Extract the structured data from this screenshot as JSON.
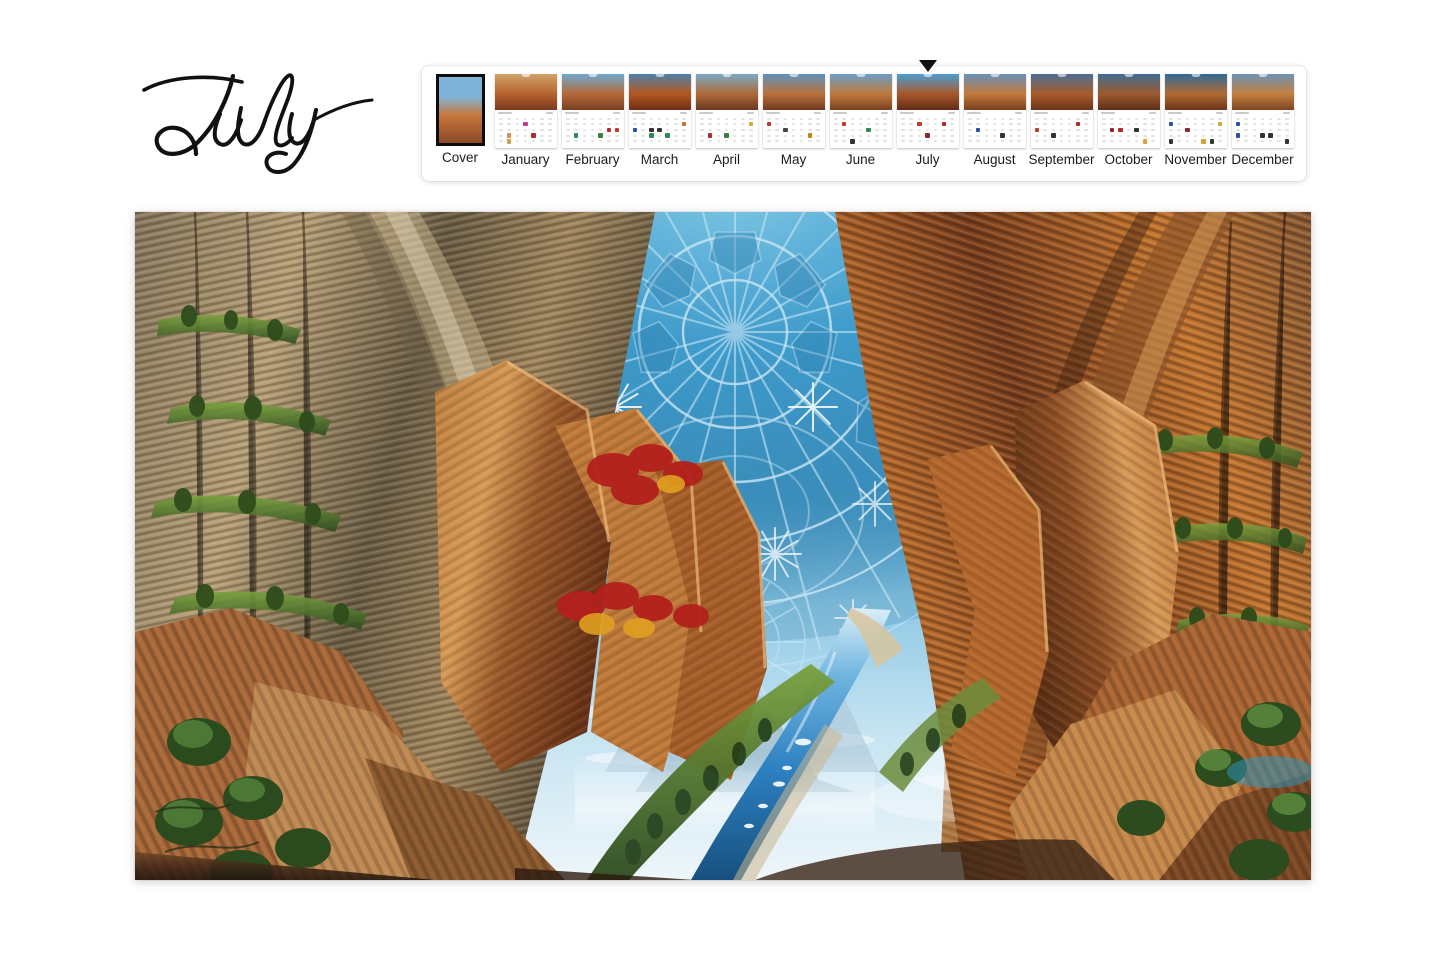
{
  "page": {
    "background_color": "#ffffff",
    "month_title": "July",
    "title_style": "handwritten-script"
  },
  "thumbnail_strip": {
    "selected": "July",
    "selected_marker_icon": "caret-down-icon",
    "cover_highlighted": true,
    "items": [
      {
        "label": "Cover",
        "type": "cover",
        "photo_top": "#7fb4d8",
        "photo_mid": "#c8763c",
        "photo_bot": "#8a4a2a"
      },
      {
        "label": "January",
        "type": "month",
        "photo_top": "#cfa36a",
        "photo_mid": "#b5632e",
        "photo_bot": "#7a3a1e",
        "dots": [
          {
            "r": 1,
            "c": 3,
            "color": "#c0399a"
          },
          {
            "r": 3,
            "c": 1,
            "color": "#d98c55"
          },
          {
            "r": 3,
            "c": 4,
            "color": "#b02b2b"
          },
          {
            "r": 4,
            "c": 1,
            "color": "#caa04a"
          }
        ]
      },
      {
        "label": "February",
        "type": "month",
        "photo_top": "#6fa8cf",
        "photo_mid": "#b4693a",
        "photo_bot": "#7d3f22",
        "dots": [
          {
            "r": 2,
            "c": 5,
            "color": "#b02b2b"
          },
          {
            "r": 2,
            "c": 6,
            "color": "#c0392b"
          },
          {
            "r": 3,
            "c": 1,
            "color": "#2e8b57"
          },
          {
            "r": 3,
            "c": 4,
            "color": "#3a7d44"
          }
        ]
      },
      {
        "label": "March",
        "type": "month",
        "photo_top": "#4f7fa8",
        "photo_mid": "#b4571f",
        "photo_bot": "#6e2f14",
        "dots": [
          {
            "r": 1,
            "c": 6,
            "color": "#c87137"
          },
          {
            "r": 2,
            "c": 0,
            "color": "#2a4fa8"
          },
          {
            "r": 2,
            "c": 2,
            "color": "#333333"
          },
          {
            "r": 2,
            "c": 3,
            "color": "#333333"
          },
          {
            "r": 3,
            "c": 2,
            "color": "#2e8b57"
          },
          {
            "r": 3,
            "c": 4,
            "color": "#2e8b57"
          }
        ]
      },
      {
        "label": "April",
        "type": "month",
        "photo_top": "#7aa9c4",
        "photo_mid": "#ad6a39",
        "photo_bot": "#6b3a20",
        "dots": [
          {
            "r": 1,
            "c": 6,
            "color": "#e0a83c"
          },
          {
            "r": 3,
            "c": 1,
            "color": "#b02b2b"
          },
          {
            "r": 3,
            "c": 3,
            "color": "#3a7d44"
          }
        ]
      },
      {
        "label": "May",
        "type": "month",
        "photo_top": "#5f93bb",
        "photo_mid": "#b9713c",
        "photo_bot": "#72391f",
        "dots": [
          {
            "r": 1,
            "c": 0,
            "color": "#c0392b"
          },
          {
            "r": 2,
            "c": 2,
            "color": "#444444"
          },
          {
            "r": 3,
            "c": 5,
            "color": "#b8860b"
          }
        ]
      },
      {
        "label": "June",
        "type": "month",
        "photo_top": "#6b9fc6",
        "photo_mid": "#c07a3e",
        "photo_bot": "#7a4120",
        "dots": [
          {
            "r": 1,
            "c": 1,
            "color": "#c0392b"
          },
          {
            "r": 2,
            "c": 4,
            "color": "#2e8b57"
          },
          {
            "r": 4,
            "c": 2,
            "color": "#333333"
          }
        ]
      },
      {
        "label": "July",
        "type": "month",
        "photo_top": "#4a9fd4",
        "photo_mid": "#a9582a",
        "photo_bot": "#5f2c16",
        "dots": [
          {
            "r": 1,
            "c": 2,
            "color": "#c0392b"
          },
          {
            "r": 1,
            "c": 5,
            "color": "#b02b2b"
          },
          {
            "r": 3,
            "c": 3,
            "color": "#8a2a2a"
          }
        ]
      },
      {
        "label": "August",
        "type": "month",
        "photo_top": "#6892b8",
        "photo_mid": "#c2793c",
        "photo_bot": "#7b401f",
        "dots": [
          {
            "r": 2,
            "c": 1,
            "color": "#2a4fa8"
          },
          {
            "r": 3,
            "c": 4,
            "color": "#333333"
          }
        ]
      },
      {
        "label": "September",
        "type": "month",
        "photo_top": "#4a6f93",
        "photo_mid": "#a85c2c",
        "photo_bot": "#6a3318",
        "dots": [
          {
            "r": 1,
            "c": 5,
            "color": "#b02b2b"
          },
          {
            "r": 2,
            "c": 0,
            "color": "#c0392b"
          },
          {
            "r": 3,
            "c": 2,
            "color": "#333333"
          }
        ]
      },
      {
        "label": "October",
        "type": "month",
        "photo_top": "#3d6d93",
        "photo_mid": "#9c5a30",
        "photo_bot": "#5d2f17",
        "dots": [
          {
            "r": 2,
            "c": 1,
            "color": "#8a2a2a"
          },
          {
            "r": 2,
            "c": 2,
            "color": "#b02b2b"
          },
          {
            "r": 2,
            "c": 4,
            "color": "#333333"
          },
          {
            "r": 4,
            "c": 5,
            "color": "#d9a13a"
          }
        ]
      },
      {
        "label": "November",
        "type": "month",
        "photo_top": "#2f6a96",
        "photo_mid": "#b06a33",
        "photo_bot": "#6c3419",
        "dots": [
          {
            "r": 1,
            "c": 0,
            "color": "#2a4fa8"
          },
          {
            "r": 1,
            "c": 6,
            "color": "#d9a13a"
          },
          {
            "r": 2,
            "c": 2,
            "color": "#8a2a2a"
          },
          {
            "r": 4,
            "c": 0,
            "color": "#333333"
          },
          {
            "r": 4,
            "c": 4,
            "color": "#d9a13a"
          },
          {
            "r": 4,
            "c": 5,
            "color": "#333333"
          }
        ]
      },
      {
        "label": "December",
        "type": "month",
        "photo_top": "#6d93b5",
        "photo_mid": "#c38040",
        "photo_bot": "#7d4420",
        "dots": [
          {
            "r": 1,
            "c": 0,
            "color": "#2a4fa8"
          },
          {
            "r": 3,
            "c": 0,
            "color": "#2a4fa8"
          },
          {
            "r": 3,
            "c": 3,
            "color": "#333333"
          },
          {
            "r": 3,
            "c": 4,
            "color": "#333333"
          },
          {
            "r": 4,
            "c": 6,
            "color": "#333333"
          }
        ]
      }
    ]
  },
  "hero": {
    "alt": "Surreal canyon landscape with mandala sky",
    "watermark_center": "",
    "watermark_right": "",
    "palette": {
      "sky_mandala": "#2f9fd4",
      "sky_light": "#cfe8f5",
      "rock_orange": "#c4702f",
      "rock_red": "#8e3a1c",
      "rock_tan": "#d8b487",
      "foliage_green": "#4b7a35",
      "river_blue": "#2f86c8",
      "shadow_dark": "#2a1a14"
    }
  }
}
